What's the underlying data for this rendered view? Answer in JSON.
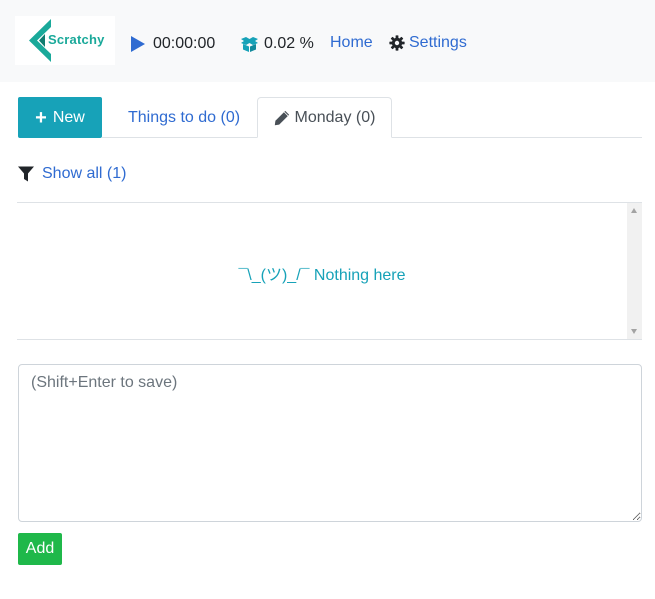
{
  "header": {
    "logo_text": "Scratchy",
    "timer": "00:00:00",
    "usage": "0.02 %",
    "home_label": "Home",
    "settings_label": "Settings"
  },
  "toolbar": {
    "new_label": "New",
    "tabs": [
      {
        "label": "Things to do (0)",
        "active": false
      },
      {
        "label": "Monday (0)",
        "active": true
      }
    ]
  },
  "filter": {
    "label": "Show all (1)"
  },
  "list": {
    "empty_message": "¯\\_(ツ)_/¯ Nothing here"
  },
  "editor": {
    "placeholder": "(Shift+Enter to save)",
    "value": "",
    "add_label": "Add"
  },
  "colors": {
    "brand_green": "#1aa99a",
    "link_blue": "#2f6bd1",
    "info_teal": "#17a2b8",
    "success_green": "#1fb84a"
  },
  "icons": {
    "timer": "play-icon",
    "usage": "boxes-icon",
    "settings": "gear-icon",
    "edit": "pencil-icon",
    "filter": "filter-icon",
    "new": "plus-icon"
  }
}
